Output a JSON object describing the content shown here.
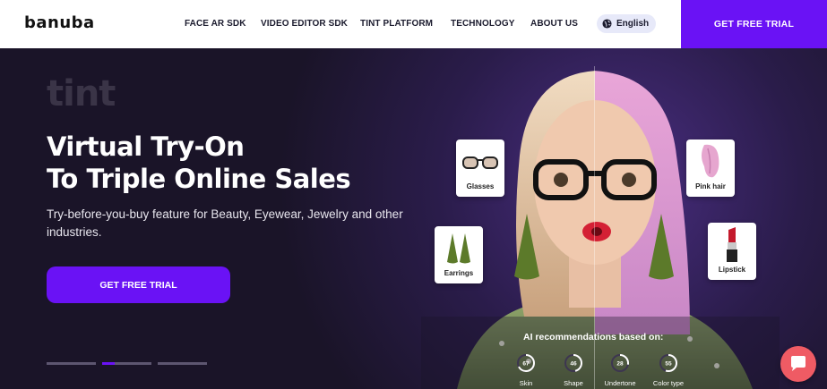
{
  "header": {
    "logo": "banuba",
    "nav": [
      {
        "label": "FACE AR SDK"
      },
      {
        "label": "VIDEO EDITOR SDK"
      },
      {
        "label": "TINT PLATFORM"
      },
      {
        "label": "TECHNOLOGY"
      },
      {
        "label": "ABOUT US"
      }
    ],
    "language": "English",
    "cta": "GET FREE TRIAL"
  },
  "hero": {
    "brand_word": "tint",
    "headline_line1": "Virtual Try-On",
    "headline_line2": "To Triple Online Sales",
    "subtitle": "Try-before-you-buy feature for Beauty, Eyewear, Jewelry and other industries.",
    "cta": "GET FREE TRIAL",
    "slider_active_index": 1
  },
  "tryon_cards": [
    {
      "label": "Glasses",
      "icon": "glasses-icon"
    },
    {
      "label": "Earrings",
      "icon": "earrings-icon"
    },
    {
      "label": "Pink hair",
      "icon": "hair-swatch-icon"
    },
    {
      "label": "Lipstick",
      "icon": "lipstick-icon"
    }
  ],
  "ai": {
    "title": "AI recommendations based on:",
    "metrics": [
      {
        "label": "Skin",
        "value": "67"
      },
      {
        "label": "Shape",
        "value": "46"
      },
      {
        "label": "Undertone",
        "value": "28"
      },
      {
        "label": "Color type",
        "value": "55"
      }
    ]
  },
  "colors": {
    "brand_purple": "#6a12f5",
    "hero_bg": "#1a1428",
    "chat_button": "#ef5b64"
  }
}
